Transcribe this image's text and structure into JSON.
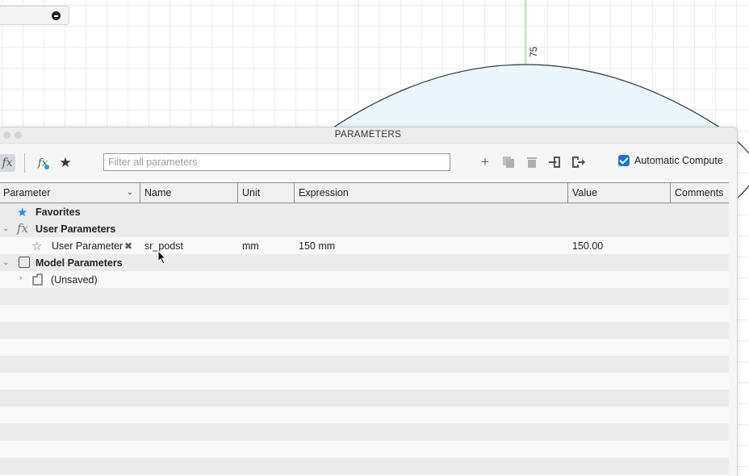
{
  "canvas": {
    "dimension_label": "75"
  },
  "panel": {
    "title": "PARAMETERS"
  },
  "toolbar": {
    "fx_icon": "function-icon",
    "user_fx_icon": "user-function-icon",
    "favorites_icon": "star-icon",
    "filter_placeholder": "Filter all parameters",
    "actions": [
      "add-icon",
      "copy-icon",
      "delete-icon",
      "import-icon",
      "export-icon"
    ],
    "automatic_compute_label": "Automatic Compute",
    "automatic_compute_checked": true
  },
  "table": {
    "columns": [
      "Parameter",
      "Name",
      "Unit",
      "Expression",
      "Value",
      "Comments"
    ],
    "favorites_label": "Favorites",
    "user_parameters_label": "User Parameters",
    "user_param": {
      "label": "User Parameter",
      "name": "sr_podst",
      "unit": "mm",
      "expression": "150 mm",
      "value": "150.00",
      "comments": ""
    },
    "model_parameters_label": "Model Parameters",
    "unsaved_label": "(Unsaved)"
  },
  "colors": {
    "accent": "#1a73e8",
    "star_blue": "#2a8fd8",
    "circle_fill": "#eaf6fb"
  }
}
